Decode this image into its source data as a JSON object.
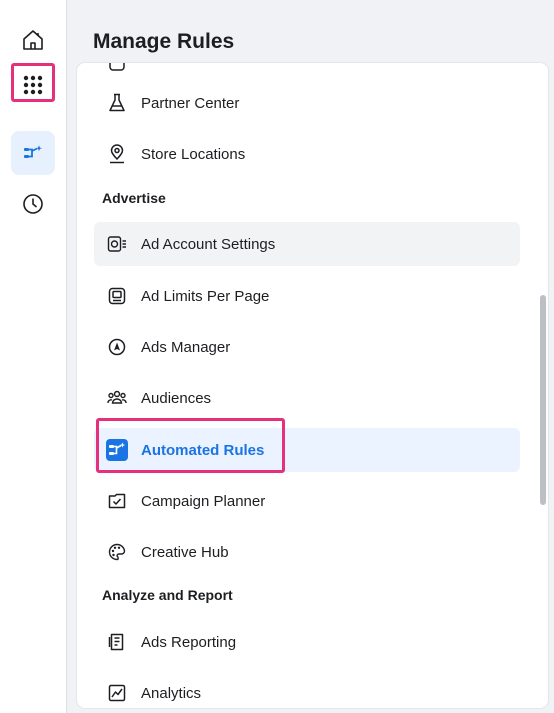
{
  "header": {
    "title": "Manage Rules"
  },
  "rail": {
    "items": [
      {
        "icon": "home-icon"
      },
      {
        "icon": "apps-grid-icon"
      },
      {
        "icon": "automated-rules-icon"
      },
      {
        "icon": "clock-icon"
      }
    ]
  },
  "colors": {
    "accent": "#1b74e4",
    "highlight": "#e5307b",
    "selected_bg": "#eaf3ff"
  },
  "menu": {
    "items_top": [
      {
        "label": "Partner Center",
        "icon": "flask-icon"
      },
      {
        "label": "Store Locations",
        "icon": "location-pin-icon"
      }
    ],
    "sections": [
      {
        "heading": "Advertise",
        "items": [
          {
            "label": "Ad Account Settings",
            "icon": "ad-account-settings-icon"
          },
          {
            "label": "Ad Limits Per Page",
            "icon": "ad-limits-icon"
          },
          {
            "label": "Ads Manager",
            "icon": "navigation-arrow-icon"
          },
          {
            "label": "Audiences",
            "icon": "audiences-icon"
          },
          {
            "label": "Automated Rules",
            "icon": "automated-rules-icon"
          },
          {
            "label": "Campaign Planner",
            "icon": "campaign-planner-icon"
          },
          {
            "label": "Creative Hub",
            "icon": "palette-icon"
          }
        ]
      },
      {
        "heading": "Analyze and Report",
        "items": [
          {
            "label": "Ads Reporting",
            "icon": "ads-reporting-icon"
          },
          {
            "label": "Analytics",
            "icon": "analytics-chart-icon"
          }
        ]
      }
    ]
  }
}
